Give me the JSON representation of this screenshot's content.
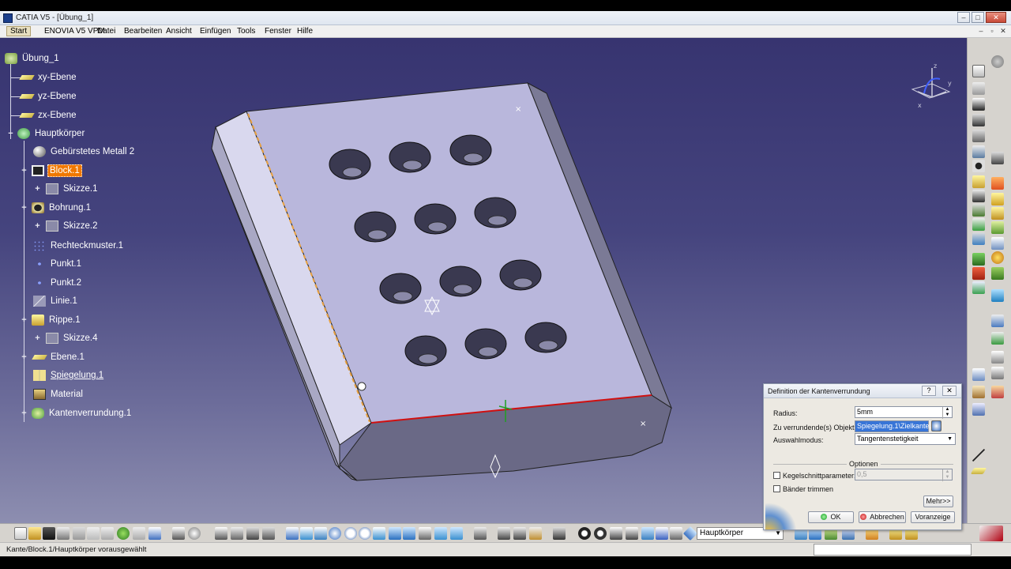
{
  "window": {
    "title": "CATIA V5 - [Übung_1]"
  },
  "menu": {
    "items": [
      "Start",
      "ENOVIA V5 VPM",
      "Datei",
      "Bearbeiten",
      "Ansicht",
      "Einfügen",
      "Tools",
      "Fenster",
      "Hilfe"
    ]
  },
  "tree": {
    "root": "Übung_1",
    "nodes": [
      {
        "label": "xy-Ebene",
        "icon": "plane-icon"
      },
      {
        "label": "yz-Ebene",
        "icon": "plane-icon"
      },
      {
        "label": "zx-Ebene",
        "icon": "plane-icon"
      },
      {
        "label": "Hauptkörper",
        "icon": "body-icon"
      },
      {
        "label": "Gebürstetes Metall 2",
        "icon": "material-sphere-icon"
      },
      {
        "label": "Block.1",
        "icon": "pad-icon",
        "selected": true
      },
      {
        "label": "Skizze.1",
        "icon": "sketch-icon"
      },
      {
        "label": "Bohrung.1",
        "icon": "hole-icon"
      },
      {
        "label": "Skizze.2",
        "icon": "sketch-icon"
      },
      {
        "label": "Rechteckmuster.1",
        "icon": "pattern-icon"
      },
      {
        "label": "Punkt.1",
        "icon": "point-icon"
      },
      {
        "label": "Punkt.2",
        "icon": "point-icon"
      },
      {
        "label": "Linie.1",
        "icon": "line-icon"
      },
      {
        "label": "Rippe.1",
        "icon": "rib-icon"
      },
      {
        "label": "Skizze.4",
        "icon": "sketch-icon"
      },
      {
        "label": "Ebene.1",
        "icon": "plane-icon"
      },
      {
        "label": "Spiegelung.1",
        "icon": "mirror-icon",
        "underline": true
      },
      {
        "label": "Material",
        "icon": "material-icon"
      },
      {
        "label": "Kantenverrundung.1",
        "icon": "edge-fillet-icon"
      }
    ]
  },
  "dialog": {
    "title": "Definition der Kantenverrundung",
    "radius_label": "Radius:",
    "radius_value": "5mm",
    "objects_label": "Zu verrundende(s) Objekt(e):",
    "objects_value": "Spiegelung.1\\Zielkante.1",
    "mode_label": "Auswahlmodus:",
    "mode_value": "Tangentenstetigkeit",
    "options_header": "Optionen",
    "conic_label": "Kegelschnittparameter:",
    "conic_value": "0,5",
    "trim_label": "Bänder trimmen",
    "more_button": "Mehr>>",
    "ok_button": "OK",
    "cancel_button": "Abbrechen",
    "preview_button": "Voranzeige"
  },
  "bottom_toolbar": {
    "current_body": "Hauptkörper"
  },
  "statusbar": {
    "text": "Kante/Block.1/Hauptkörper vorausgewählt"
  },
  "colors": {
    "viewport_top": "#373470",
    "viewport_bottom": "#8d8eb0",
    "selection": "#f07800",
    "part_top": "#b8b6da",
    "part_side": "#6f6e8c"
  },
  "compass_axes": [
    "x",
    "y",
    "z"
  ]
}
